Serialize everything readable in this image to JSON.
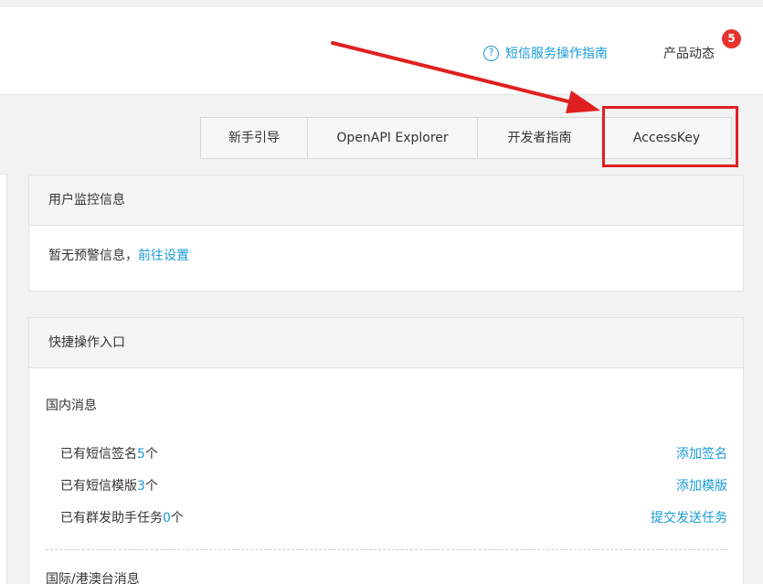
{
  "header": {
    "guide_icon": "?",
    "guide_link": "短信服务操作指南",
    "news_label": "产品动态",
    "news_badge": "5"
  },
  "toolbar": {
    "buttons": [
      {
        "label": "新手引导"
      },
      {
        "label": "OpenAPI Explorer"
      },
      {
        "label": "开发者指南"
      },
      {
        "label": "AccessKey"
      }
    ],
    "highlight_color": "#e02020"
  },
  "monitor": {
    "title": "用户监控信息",
    "message": "暂无预警信息，",
    "link": "前往设置"
  },
  "quick": {
    "title": "快捷操作入口",
    "domestic_title": "国内消息",
    "rows": [
      {
        "prefix": "已有短信签名",
        "count": "5",
        "unit": "个",
        "action": "添加签名"
      },
      {
        "prefix": "已有短信模版",
        "count": "3",
        "unit": "个",
        "action": "添加模版"
      },
      {
        "prefix": "已有群发助手任务",
        "count": "0",
        "unit": "个",
        "action": "提交发送任务"
      }
    ],
    "intl_title": "国际/港澳台消息"
  },
  "colors": {
    "accent": "#1a9bd7",
    "badge": "#e8322f",
    "annotation": "#e02020"
  }
}
